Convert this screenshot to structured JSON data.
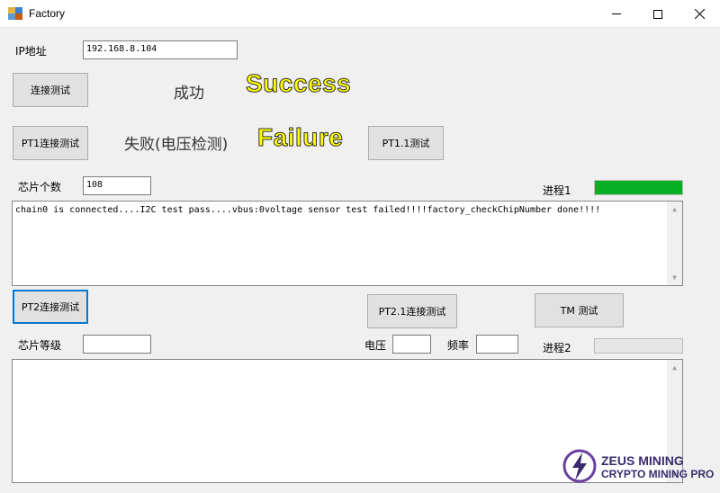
{
  "window": {
    "title": "Factory",
    "icon": "app-window-icon"
  },
  "ip": {
    "label": "IP地址",
    "value": "192.168.8.104"
  },
  "buttons": {
    "connect_test": "连接测试",
    "pt1_connect_test": "PT1连接测试",
    "pt1_1_test": "PT1.1测试",
    "pt2_connect_test": "PT2连接测试",
    "pt2_1_connect_test": "PT2.1连接测试",
    "tm_test": "TM 测试"
  },
  "status": {
    "success_cn": "成功",
    "success_en": "Success",
    "failure_cn": "失败(电压检测)",
    "failure_en": "Failure"
  },
  "chip_count": {
    "label": "芯片个数",
    "value": "108"
  },
  "progress1": {
    "label": "进程1",
    "value": 1.0,
    "color": "#06b025"
  },
  "log1": "chain0 is connected....I2C test pass....vbus:0voltage sensor test failed!!!!factory_checkChipNumber done!!!!",
  "chip_grade": {
    "label": "芯片等级",
    "value": ""
  },
  "voltage": {
    "label": "电压",
    "value": ""
  },
  "frequency": {
    "label": "频率",
    "value": ""
  },
  "progress2": {
    "label": "进程2",
    "value": 0
  },
  "log2": "",
  "watermark": {
    "line1": "ZEUS MINING",
    "line2": "CRYPTO MINING PRO",
    "icon": "lightning-logo-icon"
  },
  "colors": {
    "status_text": "#ffff00",
    "accent": "#0078d7",
    "logo": "#3a2b6e"
  }
}
